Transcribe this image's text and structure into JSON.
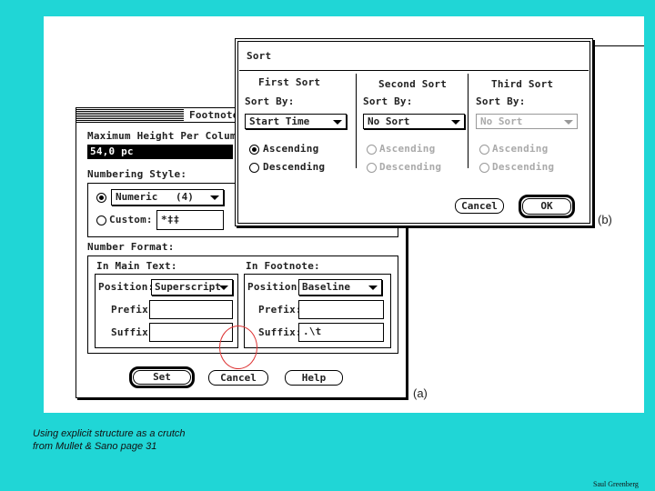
{
  "footnote_dialog": {
    "title": "Footnote",
    "max_height_label": "Maximum Height Per Colum",
    "max_height_value": "54,0 pc",
    "numbering_style_label": "Numbering Style:",
    "numeric_value": "Numeric",
    "numeric_count": "(4)",
    "custom_label": "Custom:",
    "custom_value": "*‡‡",
    "number_format_label": "Number Format:",
    "in_main_text_label": "In Main Text:",
    "in_footnote_label": "In Footnote:",
    "position_label": "Position:",
    "prefix_label": "Prefix:",
    "suffix_label": "Suffix:",
    "main_position_value": "Superscript",
    "foot_position_value": "Baseline",
    "foot_suffix_value": ".\\t",
    "set_label": "Set",
    "cancel_label": "Cancel",
    "help_label": "Help",
    "figure_label": "(a)"
  },
  "sort_dialog": {
    "title": "Sort",
    "sort_by_label": "Sort By:",
    "columns": [
      {
        "heading": "First Sort",
        "value": "Start Time",
        "ascending": "Ascending",
        "descending": "Descending"
      },
      {
        "heading": "Second Sort",
        "value": "No Sort",
        "ascending": "Ascending",
        "descending": "Descending"
      },
      {
        "heading": "Third Sort",
        "value": "No Sort",
        "ascending": "Ascending",
        "descending": "Descending"
      }
    ],
    "cancel_label": "Cancel",
    "ok_label": "OK",
    "figure_label": "(b)"
  },
  "caption": {
    "line1": "Using explicit structure as a crutch",
    "line2": "from Mullet & Sano page 31"
  },
  "credit": "Saul Greenberg"
}
